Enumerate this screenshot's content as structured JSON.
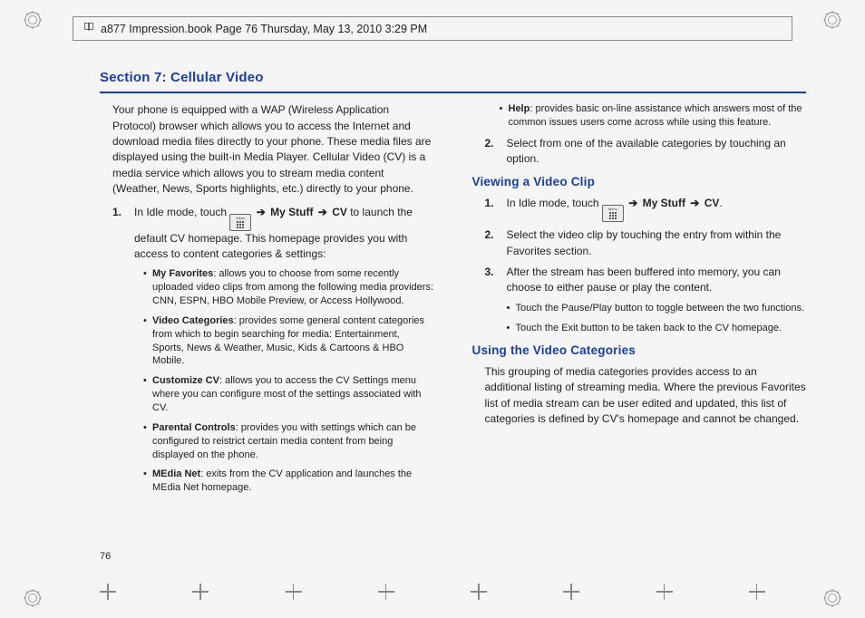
{
  "header": {
    "text": "a877 Impression.book  Page 76  Thursday, May 13, 2010  3:29 PM"
  },
  "section_title": "Section 7:  Cellular Video",
  "page_number": "76",
  "col1": {
    "intro": "Your phone is equipped with a WAP (Wireless Application Protocol) browser which allows you to access the Internet and download media files directly to your phone. These media files are displayed using the built-in Media Player. Cellular Video (CV) is a media service which allows you to stream media content (Weather, News, Sports highlights, etc.) directly to your phone.",
    "step1_num": "1.",
    "step1_prefix": "In Idle mode, touch ",
    "arrow": " ➔ ",
    "mystuff": "My Stuff",
    "cv": "CV",
    "step1_suffix": " to launch the default CV homepage. This homepage provides you with access to content categories & settings:",
    "bullets": [
      {
        "t": "My Favorites",
        "b": ": allows you to choose from some recently uploaded video clips from among the following media providers: CNN, ESPN, HBO Mobile Preview, or Access Hollywood."
      },
      {
        "t": "Video Categories",
        "b": ": provides some general content categories from which to begin searching for media: Entertainment, Sports, News & Weather, Music, Kids & Cartoons & HBO Mobile."
      },
      {
        "t": "Customize CV",
        "b": ": allows you to access the CV Settings menu where you can configure most of the settings associated with CV."
      },
      {
        "t": "Parental Controls",
        "b": ": provides you with settings which can be configured to reistrict certain media content from being displayed on the phone."
      },
      {
        "t": "MEdia Net",
        "b": ": exits from the CV application and launches the MEdia Net homepage."
      }
    ]
  },
  "col2": {
    "help_t": "Help",
    "help_b": ": provides basic on-line assistance which answers most of the common issues users come across while using this feature.",
    "step2_num": "2.",
    "step2": "Select from one of the available categories by touching an option.",
    "viewing_h": "Viewing a Video Clip",
    "v1_num": "1.",
    "v1": "In Idle mode, touch ",
    "v1_end": ".",
    "v2_num": "2.",
    "v2": "Select the video clip by touching the entry from within the Favorites section.",
    "v3_num": "3.",
    "v3": "After the stream has been buffered into memory, you can choose to either pause or play the content.",
    "v3_b1": "Touch the Pause/Play button to toggle between the two functions.",
    "v3_b2": "Touch the Exit button to be taken back to the CV homepage.",
    "using_h": "Using the Video Categories",
    "using_p": "This grouping of media categories provides access to an additional listing of streaming media. Where the previous Favorites list of media stream can be user edited and updated, this list of categories is defined by CV's homepage and cannot be changed."
  }
}
